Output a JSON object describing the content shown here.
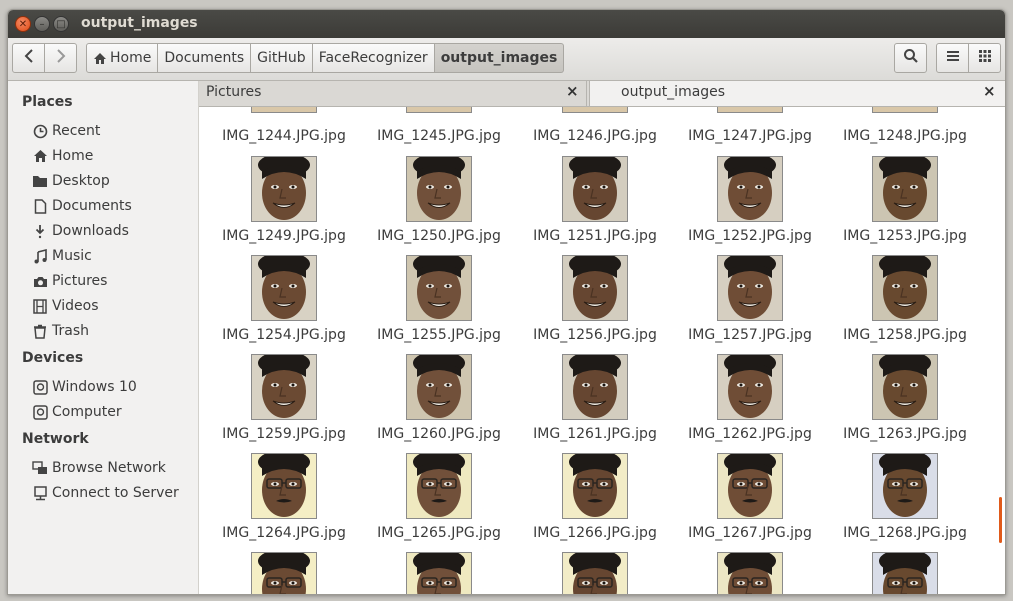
{
  "window": {
    "title": "output_images"
  },
  "toolbar": {
    "back_label": "‹",
    "forward_label": "›",
    "breadcrumbs": [
      "Home",
      "Documents",
      "GitHub",
      "FaceRecognizer",
      "output_images"
    ]
  },
  "sidebar": {
    "places_title": "Places",
    "places": [
      {
        "label": "Recent",
        "icon": "clock-icon"
      },
      {
        "label": "Home",
        "icon": "home-icon"
      },
      {
        "label": "Desktop",
        "icon": "folder-icon"
      },
      {
        "label": "Documents",
        "icon": "document-icon"
      },
      {
        "label": "Downloads",
        "icon": "download-icon"
      },
      {
        "label": "Music",
        "icon": "music-icon"
      },
      {
        "label": "Pictures",
        "icon": "camera-icon"
      },
      {
        "label": "Videos",
        "icon": "film-icon"
      },
      {
        "label": "Trash",
        "icon": "trash-icon"
      }
    ],
    "devices_title": "Devices",
    "devices": [
      {
        "label": "Windows 10",
        "icon": "drive-icon"
      },
      {
        "label": "Computer",
        "icon": "drive-icon"
      }
    ],
    "network_title": "Network",
    "network": [
      {
        "label": "Browse Network",
        "icon": "network-icon"
      },
      {
        "label": "Connect to Server",
        "icon": "server-icon"
      }
    ]
  },
  "tabs": [
    {
      "label": "Pictures"
    },
    {
      "label": "output_images"
    }
  ],
  "files": {
    "top_row": [
      "IMG_1244.JPG.jpg",
      "IMG_1245.JPG.jpg",
      "IMG_1246.JPG.jpg",
      "IMG_1247.JPG.jpg",
      "IMG_1248.JPG.jpg"
    ],
    "rows": [
      [
        "IMG_1249.JPG.jpg",
        "IMG_1250.JPG.jpg",
        "IMG_1251.JPG.jpg",
        "IMG_1252.JPG.jpg",
        "IMG_1253.JPG.jpg"
      ],
      [
        "IMG_1254.JPG.jpg",
        "IMG_1255.JPG.jpg",
        "IMG_1256.JPG.jpg",
        "IMG_1257.JPG.jpg",
        "IMG_1258.JPG.jpg"
      ],
      [
        "IMG_1259.JPG.jpg",
        "IMG_1260.JPG.jpg",
        "IMG_1261.JPG.jpg",
        "IMG_1262.JPG.jpg",
        "IMG_1263.JPG.jpg"
      ],
      [
        "IMG_1264.JPG.jpg",
        "IMG_1265.JPG.jpg",
        "IMG_1266.JPG.jpg",
        "IMG_1267.JPG.jpg",
        "IMG_1268.JPG.jpg"
      ]
    ]
  }
}
